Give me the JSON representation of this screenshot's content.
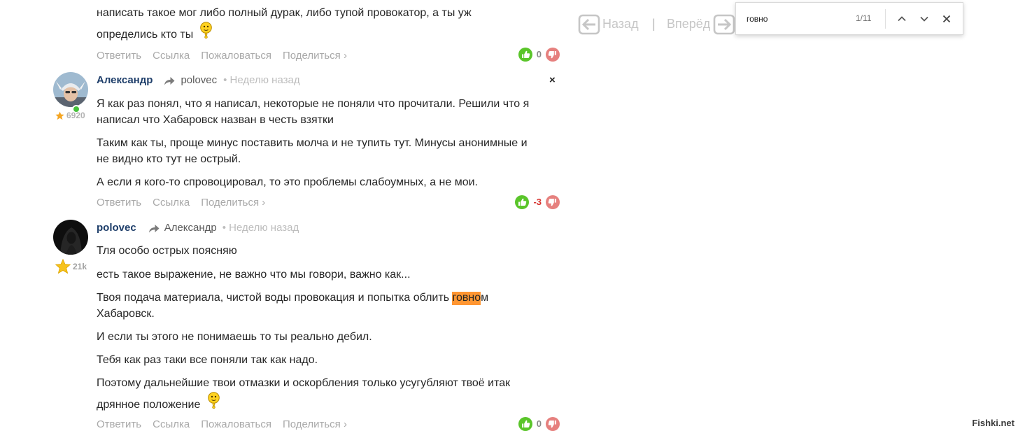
{
  "nav": {
    "back_label": "Назад",
    "separator": "|",
    "forward_label": "Вперёд"
  },
  "find_bar": {
    "query": "говно",
    "match_count": "1/11"
  },
  "comments": [
    {
      "lines": [
        "написать такое мог либо полный дурак, либо тупой провокатор, а ты уж",
        "определись кто ты"
      ],
      "actions": [
        "Ответить",
        "Ссылка",
        "Пожаловаться",
        "Поделиться ›"
      ],
      "score": "0"
    },
    {
      "author": "Александр",
      "reply_to": "polovec",
      "time": "• Неделю назад",
      "rating": "6920",
      "online": true,
      "close_label": "×",
      "paragraphs": [
        [
          "Я как раз понял, что я написал, некоторые не поняли что прочитали. Решили что я",
          "написал что Хабаровск назван в честь взятки"
        ],
        [
          "Таким как ты, проще минус поставить молча и не тупить тут. Минусы анонимные и",
          "не видно кто тут не острый."
        ],
        [
          "А если я кого-то спровоцировал, то это проблемы слабоумных, а не мои."
        ]
      ],
      "actions": [
        "Ответить",
        "Ссылка",
        "Поделиться ›"
      ],
      "score": "-3"
    },
    {
      "author": "polovec",
      "reply_to": "Александр",
      "time": "• Неделю назад",
      "rating": "21k",
      "paragraphs": [
        [
          "Тля особо острых поясняю"
        ],
        [
          "есть такое выражение, не важно что мы говори, важно как..."
        ],
        [
          {
            "before": "Твоя подача материала, чистой воды провокация и попытка облить ",
            "match": "говно",
            "after": "м"
          },
          "Хабаровск."
        ],
        [
          "И если ты этого не понимаешь то ты реально дебил."
        ],
        [
          "Тебя как раз таки все поняли так как надо."
        ],
        [
          "Поэтому дальнейшие твои отмазки и оскорбления только усугубляют твоё итак",
          "дрянное положение"
        ]
      ],
      "actions": [
        "Ответить",
        "Ссылка",
        "Пожаловаться",
        "Поделиться ›"
      ],
      "score": "0"
    }
  ],
  "watermark": "Fishki.net",
  "icons": {
    "upvote": "thumbs-up-icon",
    "downvote": "thumbs-down-icon",
    "reply": "reply-arrow-icon",
    "rating": "star-icon",
    "emoji": "question-smiley-icon",
    "nav_back": "arrow-left-box-icon",
    "nav_forward": "arrow-right-box-icon",
    "find_prev": "chevron-up-icon",
    "find_next": "chevron-down-icon",
    "find_close": "close-icon"
  },
  "colors": {
    "author_name": "#1e3e6a",
    "action_link": "#a9a9a9",
    "upvote": "#5ac52a",
    "downvote": "#e6807e",
    "negative_score": "#d7322d",
    "find_highlight": "#ff9632",
    "online": "#46c23a"
  }
}
